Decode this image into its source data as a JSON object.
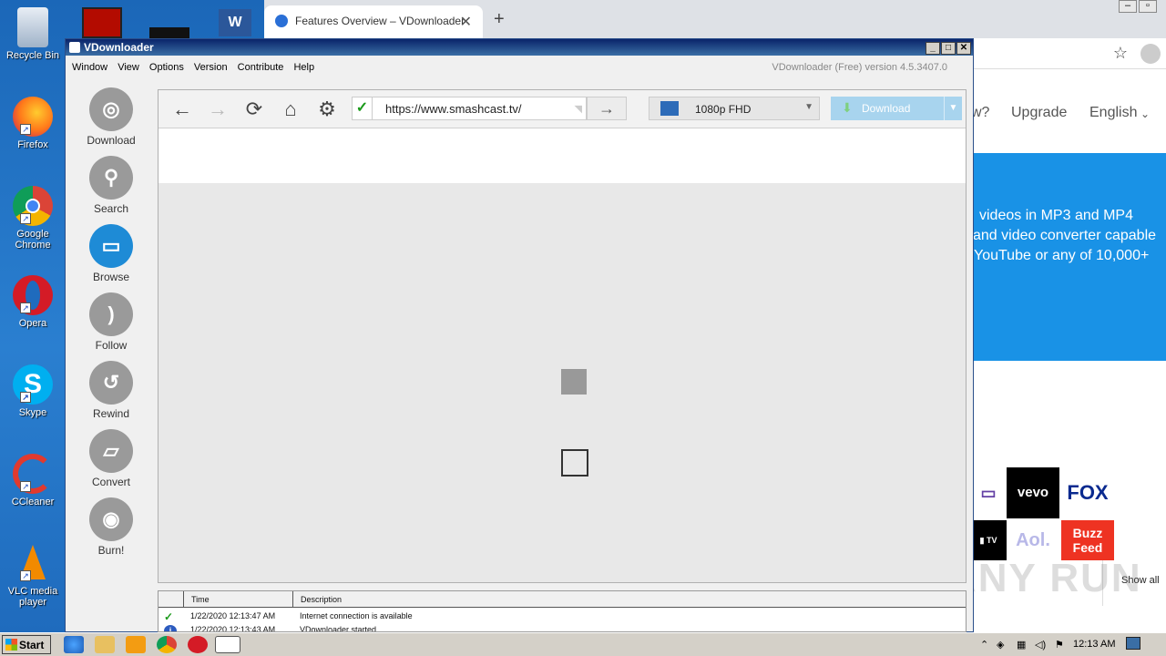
{
  "desktop": {
    "icons": [
      {
        "label": "Recycle Bin"
      },
      {
        "label": "Firefox"
      },
      {
        "label": "Google Chrome"
      },
      {
        "label": "Opera"
      },
      {
        "label": "Skype"
      },
      {
        "label": "CCleaner"
      },
      {
        "label": "VLC media player"
      }
    ]
  },
  "chrome": {
    "tab_title": "Features Overview – VDownloader",
    "nav": {
      "partial": "w?",
      "upgrade": "Upgrade",
      "language": "English"
    },
    "hero_lines": [
      "videos in MP3 and MP4",
      "and video converter capable",
      "YouTube or any of 10,000+"
    ],
    "logos": [
      "vevo",
      "FOX",
      "Buzz Feed",
      "Aol."
    ],
    "show_all": "Show all",
    "watermark": "ANY RUN"
  },
  "vd": {
    "title": "VDownloader",
    "menu": [
      "Window",
      "View",
      "Options",
      "Version",
      "Contribute",
      "Help"
    ],
    "version_text": "VDownloader (Free) version 4.5.3407.0",
    "sidebar": [
      "Download",
      "Search",
      "Browse",
      "Follow",
      "Rewind",
      "Convert",
      "Burn!"
    ],
    "url": "https://www.smashcast.tv/",
    "quality": "1080p FHD",
    "download_label": "Download",
    "log": {
      "headers": {
        "time": "Time",
        "description": "Description"
      },
      "rows": [
        {
          "time": "1/22/2020 12:13:47 AM",
          "description": "Internet connection is available"
        },
        {
          "time": "1/22/2020 12:13:43 AM",
          "description": "VDownloader started"
        }
      ]
    }
  },
  "taskbar": {
    "start_label": "Start",
    "clock": "12:13 AM"
  }
}
